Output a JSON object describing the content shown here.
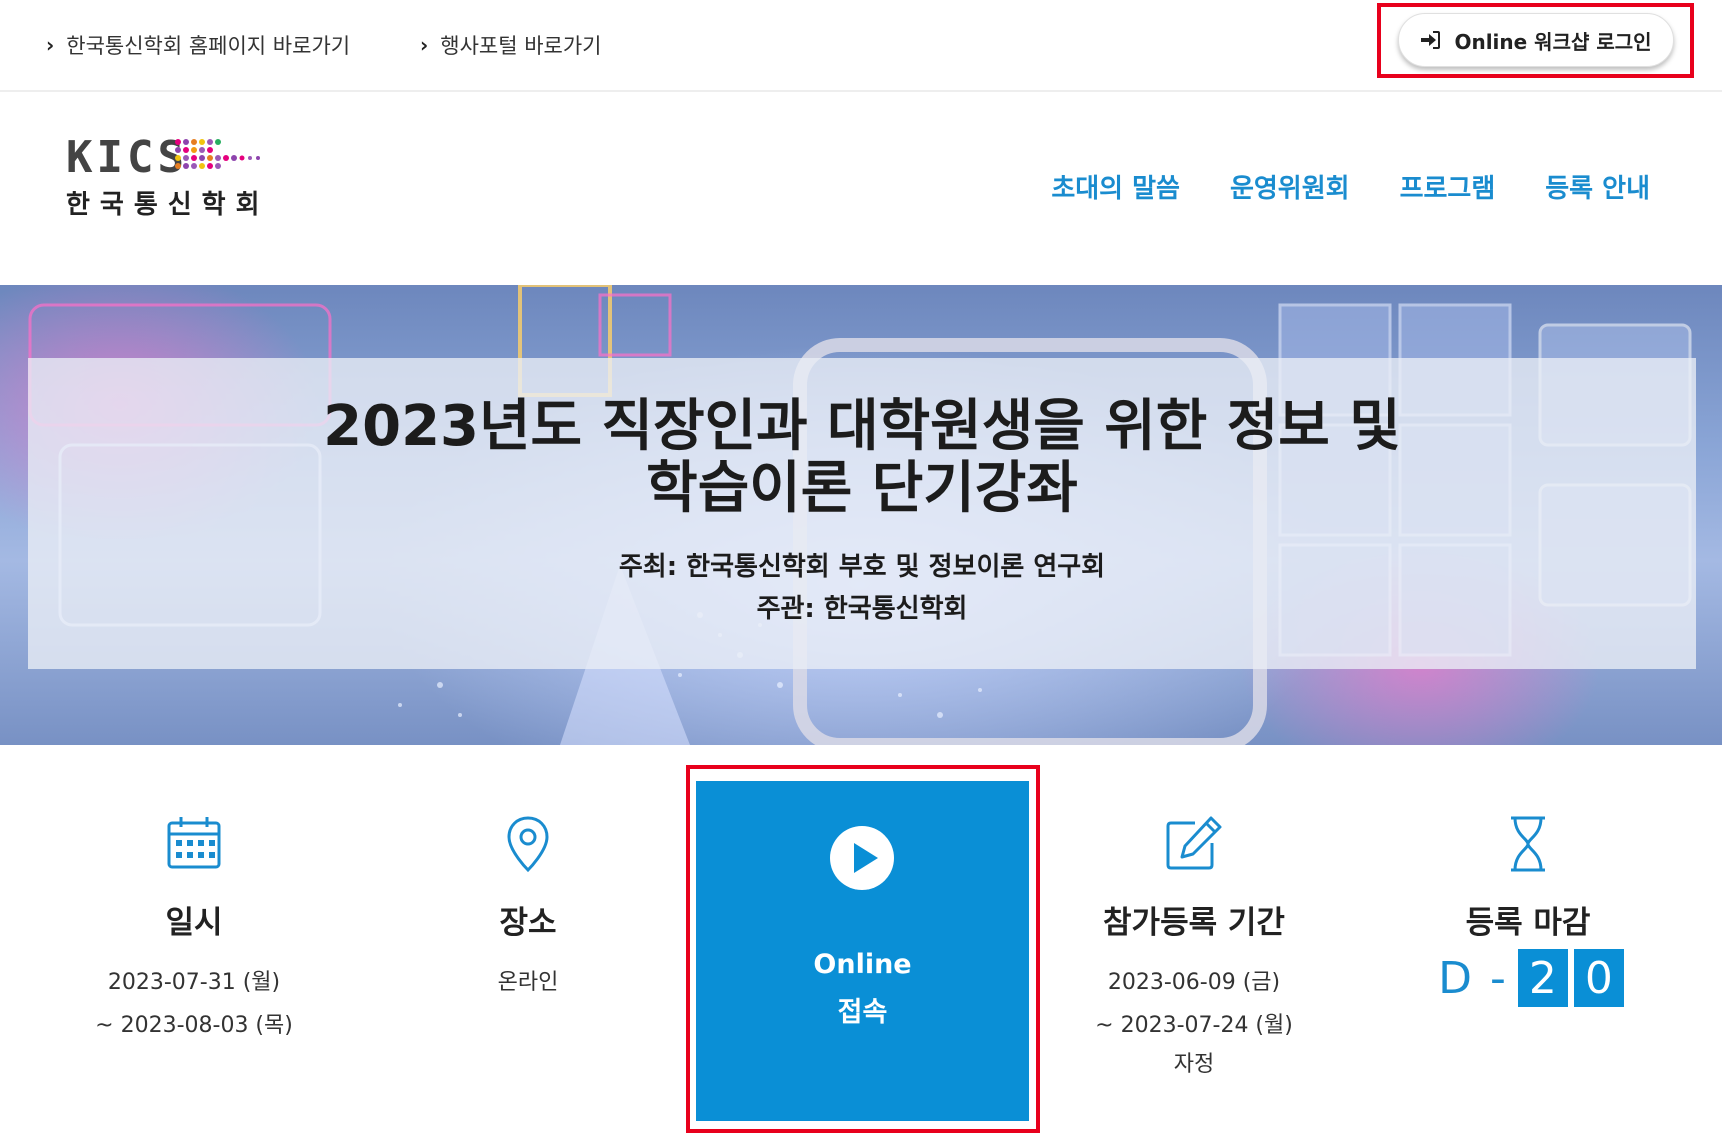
{
  "topbar": {
    "links": [
      {
        "label": "한국통신학회 홈페이지 바로가기"
      },
      {
        "label": "행사포털 바로가기"
      }
    ],
    "login_label": "Online 워크샵 로그인"
  },
  "header": {
    "logo_text": "KICS",
    "logo_korean": "한국통신학회",
    "nav": [
      {
        "label": "초대의 말씀"
      },
      {
        "label": "운영위원회"
      },
      {
        "label": "프로그램"
      },
      {
        "label": "등록 안내"
      }
    ]
  },
  "hero": {
    "title_line1": "2023년도 직장인과 대학원생을 위한 정보 및",
    "title_line2": "학습이론 단기강좌",
    "host": "주최: 한국통신학회 부호 및 정보이론 연구회",
    "organizer": "주관: 한국통신학회"
  },
  "info": {
    "date": {
      "title": "일시",
      "line1": "2023-07-31 (월)",
      "line2": "~ 2023-08-03 (목)"
    },
    "place": {
      "title": "장소",
      "line1": "온라인"
    },
    "online": {
      "line1": "Online",
      "line2": "접속"
    },
    "registration": {
      "title": "참가등록 기간",
      "line1": "2023-06-09 (금)",
      "line2": "~ 2023-07-24 (월)",
      "line3": "자정"
    },
    "deadline": {
      "title": "등록 마감",
      "d": "D",
      "dash": "-",
      "digit1": "2",
      "digit2": "0"
    }
  },
  "colors": {
    "accent": "#1a8ccf",
    "card": "#0a8fd6",
    "highlight": "#e8001c"
  }
}
